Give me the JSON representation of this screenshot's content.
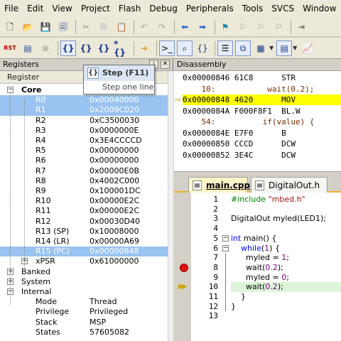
{
  "menu": [
    "File",
    "Edit",
    "View",
    "Project",
    "Flash",
    "Debug",
    "Peripherals",
    "Tools",
    "SVCS",
    "Window"
  ],
  "toolbar1": {
    "icons": [
      "new-file-icon",
      "open-folder-icon",
      "save-icon",
      "save-all-icon",
      "cut-icon",
      "copy-icon",
      "paste-icon",
      "undo-icon",
      "redo-icon",
      "nav-back-icon",
      "nav-forward-icon",
      "bookmark-icon",
      "bookmark-prev-icon",
      "bookmark-next-icon",
      "bookmark-clear-icon"
    ]
  },
  "toolbar2": {
    "icons": [
      "reset-icon",
      "run-icon",
      "stop-icon",
      "step-into-icon",
      "step-over-icon",
      "step-out-icon",
      "run-to-cursor-icon",
      "show-next-statement-icon",
      "command-window-icon",
      "disassembly-window-icon",
      "symbols-window-icon",
      "registers-window-icon",
      "call-stack-window-icon",
      "watch-window-icon",
      "memory-window-icon"
    ],
    "reset_label": "RST"
  },
  "registers": {
    "title": "Registers",
    "column_header": "Register",
    "groups": {
      "core": "Core",
      "banked": "Banked",
      "system": "System",
      "internal": "Internal"
    },
    "rows": [
      {
        "name": "R0",
        "value": "0x00040000"
      },
      {
        "name": "R1",
        "value": "0x2009C020"
      },
      {
        "name": "R2",
        "value": "0xC3500030"
      },
      {
        "name": "R3",
        "value": "0x0000000E"
      },
      {
        "name": "R4",
        "value": "0x3E4CCCCD"
      },
      {
        "name": "R5",
        "value": "0x00000000"
      },
      {
        "name": "R6",
        "value": "0x00000000"
      },
      {
        "name": "R7",
        "value": "0x00000E0B"
      },
      {
        "name": "R8",
        "value": "0x4002C000"
      },
      {
        "name": "R9",
        "value": "0x100001DC"
      },
      {
        "name": "R10",
        "value": "0x00000E2C"
      },
      {
        "name": "R11",
        "value": "0x00000E2C"
      },
      {
        "name": "R12",
        "value": "0x00030D40"
      },
      {
        "name": "R13 (SP)",
        "value": "0x10008000"
      },
      {
        "name": "R14 (LR)",
        "value": "0x00000A69"
      },
      {
        "name": "R15 (PC)",
        "value": "0x00000848"
      },
      {
        "name": "xPSR",
        "value": "0x61000000"
      }
    ],
    "internal": [
      {
        "name": "Mode",
        "value": "Thread"
      },
      {
        "name": "Privilege",
        "value": "Privileged"
      },
      {
        "name": "Stack",
        "value": "MSP"
      },
      {
        "name": "States",
        "value": "57605082"
      }
    ]
  },
  "tooltip": {
    "title": "Step (F11)",
    "description": "Step one line"
  },
  "disassembly": {
    "title": "Disassembly",
    "lines": [
      {
        "text": "0x00000846 61C8      STR",
        "kind": "asm"
      },
      {
        "text": "    10:           wait(0.2);",
        "kind": "src"
      },
      {
        "text": "0x00000848 4620      MOV",
        "kind": "current"
      },
      {
        "text": "0x0000084A F000F8F1  BL.W",
        "kind": "asm"
      },
      {
        "text": "    54:          if(value) {",
        "kind": "src"
      },
      {
        "text": "0x0000084E E7F0      B",
        "kind": "asm"
      },
      {
        "text": "0x00000850 CCCD      DCW",
        "kind": "asm"
      },
      {
        "text": "0x00000852 3E4C      DCW",
        "kind": "asm"
      }
    ]
  },
  "tabs": [
    {
      "label": "main.cpp"
    },
    {
      "label": "DigitalOut.h"
    }
  ],
  "editor": {
    "line_numbers": [
      "1",
      "2",
      "3",
      "4",
      "5",
      "6",
      "7",
      "8",
      "9",
      "10",
      "11",
      "12",
      "13"
    ],
    "lines": [
      {
        "parts": [
          [
            "pp",
            "#include "
          ],
          [
            "str",
            "\"mbed.h\""
          ]
        ]
      },
      {
        "parts": []
      },
      {
        "parts": [
          [
            "t",
            "DigitalOut myled(LED1);"
          ]
        ]
      },
      {
        "parts": []
      },
      {
        "parts": [
          [
            "kw",
            "int"
          ],
          [
            "t",
            " main() {"
          ]
        ]
      },
      {
        "parts": [
          [
            "t",
            "    "
          ],
          [
            "kw",
            "while"
          ],
          [
            "t",
            "("
          ],
          [
            "num",
            "1"
          ],
          [
            "t",
            ") {"
          ]
        ]
      },
      {
        "parts": [
          [
            "t",
            "      myled = "
          ],
          [
            "num",
            "1"
          ],
          [
            "t",
            ";"
          ]
        ]
      },
      {
        "parts": [
          [
            "t",
            "      wait("
          ],
          [
            "num",
            "0.2"
          ],
          [
            "t",
            ");"
          ]
        ]
      },
      {
        "parts": [
          [
            "t",
            "      myled = "
          ],
          [
            "num",
            "0"
          ],
          [
            "t",
            ";"
          ]
        ]
      },
      {
        "parts": [
          [
            "t",
            "      wait("
          ],
          [
            "num",
            "0.2"
          ],
          [
            "t",
            ");"
          ]
        ]
      },
      {
        "parts": [
          [
            "t",
            "    }"
          ]
        ]
      },
      {
        "parts": [
          [
            "t",
            "}"
          ]
        ]
      },
      {
        "parts": []
      }
    ],
    "current_line": 10,
    "breakpoint_line": 8
  }
}
